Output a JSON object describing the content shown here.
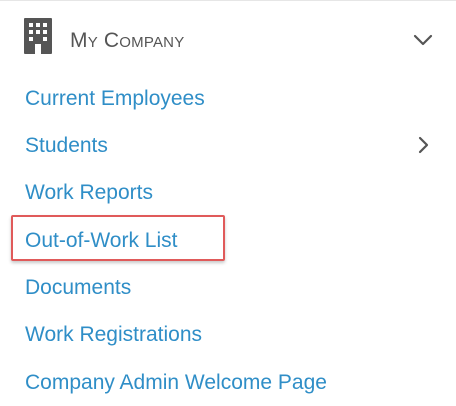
{
  "section": {
    "title": "My Company",
    "icon": "building-icon",
    "toggle_icon": "chevron-down-icon",
    "expanded": true
  },
  "nav": {
    "items": [
      {
        "label": "Current Employees"
      },
      {
        "label": "Students",
        "has_submenu": true,
        "submenu_icon": "chevron-right-icon"
      },
      {
        "label": "Work Reports"
      },
      {
        "label": "Out-of-Work List",
        "highlighted": true
      },
      {
        "label": "Documents"
      },
      {
        "label": "Work Registrations"
      },
      {
        "label": "Company Admin Welcome Page"
      }
    ]
  },
  "colors": {
    "link": "#2f8ec7",
    "header_text": "#555555",
    "icon": "#555555",
    "highlight_border": "#e05a5a",
    "divider": "#e6e6e6"
  }
}
